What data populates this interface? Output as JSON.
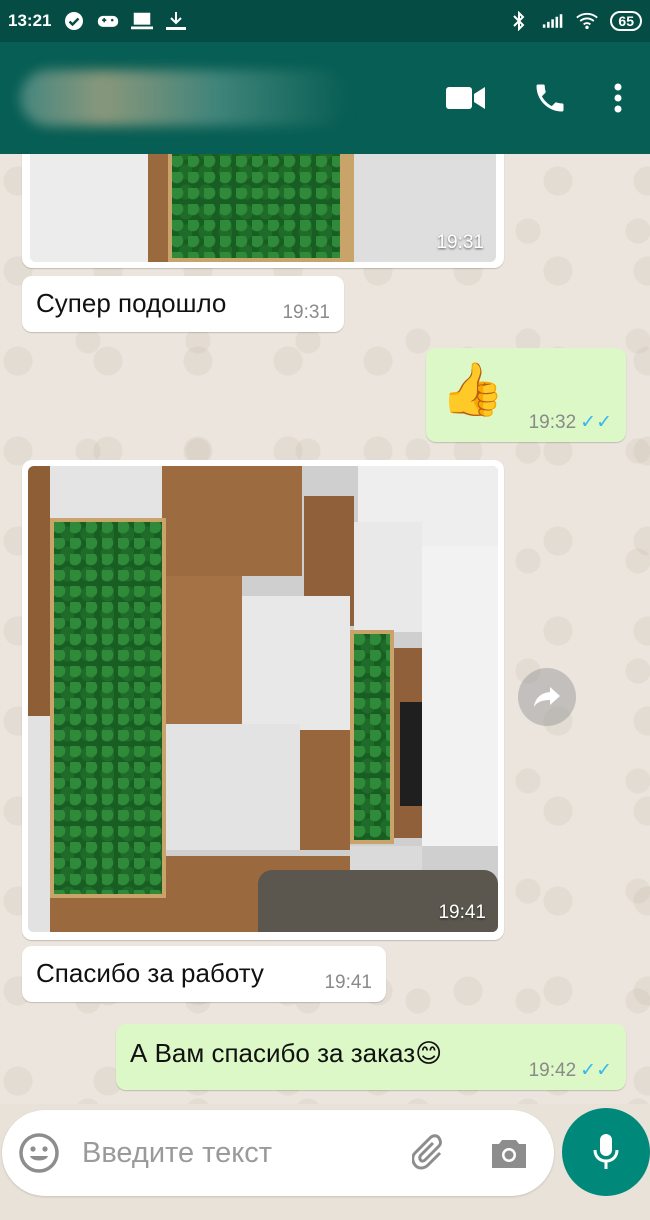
{
  "status_bar": {
    "time": "13:21",
    "battery": "65"
  },
  "messages": [
    {
      "type": "image",
      "direction": "in",
      "time": "19:31"
    },
    {
      "type": "text",
      "direction": "in",
      "text": "Супер подошло",
      "time": "19:31"
    },
    {
      "type": "emoji",
      "direction": "out",
      "text": "👍",
      "time": "19:32",
      "status": "read"
    },
    {
      "type": "image",
      "direction": "in",
      "time": "19:41"
    },
    {
      "type": "text",
      "direction": "in",
      "text": "Спасибо за работу",
      "time": "19:41"
    },
    {
      "type": "text",
      "direction": "out",
      "text": "А Вам спасибо за заказ😊",
      "time": "19:42",
      "status": "read"
    }
  ],
  "ticks": "✓✓",
  "composer": {
    "placeholder": "Введите текст"
  },
  "colors": {
    "header": "#075e54",
    "statusbar": "#054d44",
    "incoming": "#ffffff",
    "outgoing": "#dcf8c6",
    "mic": "#00897b",
    "read_ticks": "#34b7f1"
  }
}
